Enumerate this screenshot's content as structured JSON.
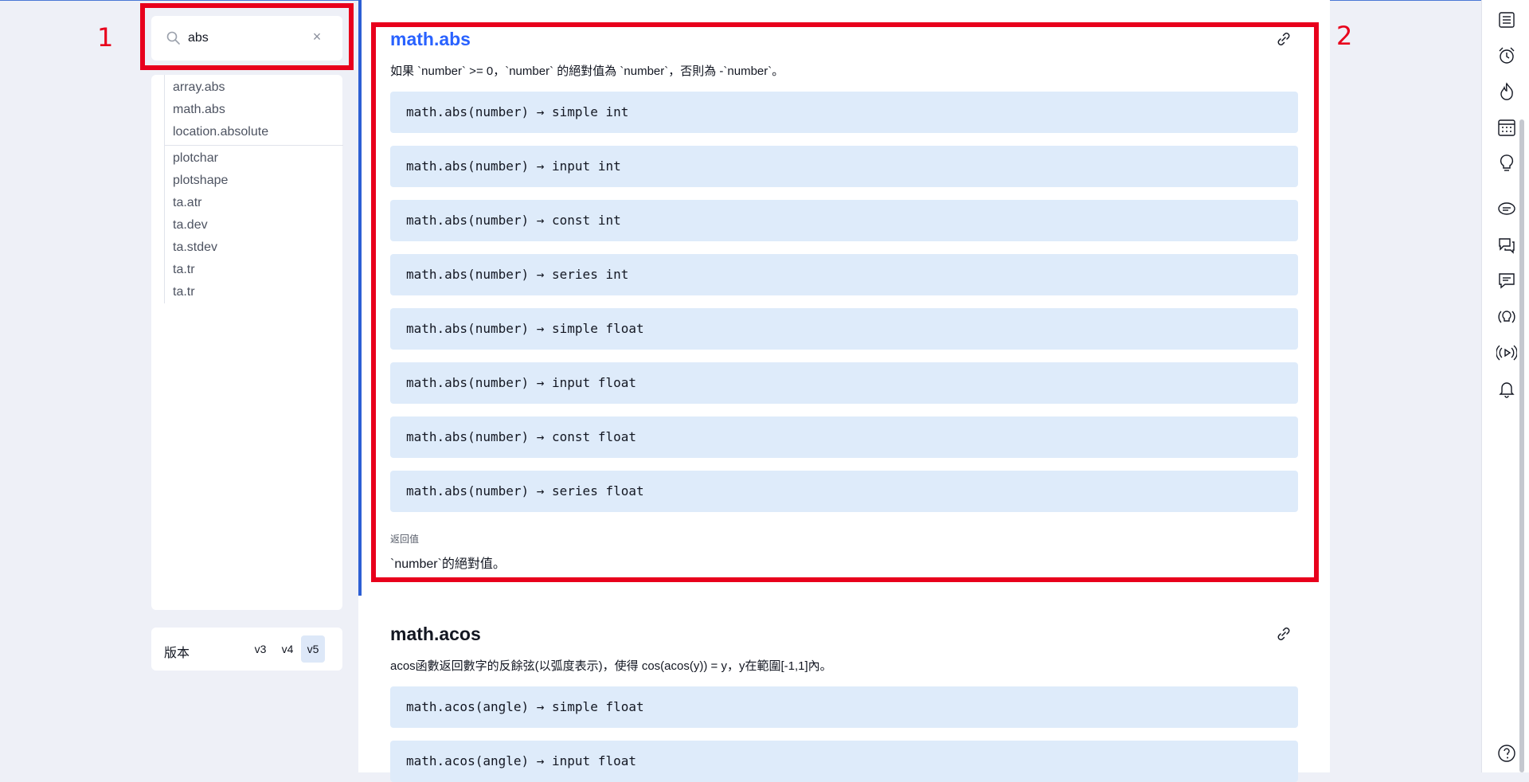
{
  "annotations": {
    "label_1": "1",
    "label_2": "2"
  },
  "search": {
    "value": "abs",
    "clear_label": "×"
  },
  "results": {
    "group_1": [
      "array.abs",
      "math.abs",
      "location.absolute"
    ],
    "group_2": [
      "plotchar",
      "plotshape",
      "ta.atr",
      "ta.dev",
      "ta.stdev",
      "ta.tr",
      "ta.tr"
    ]
  },
  "version": {
    "label": "版本",
    "options": [
      "v3",
      "v4",
      "v5"
    ],
    "selected": "v5"
  },
  "entries": [
    {
      "title": "math.abs",
      "description": "如果 `number` >= 0，`number` 的絕對值為 `number`，否則為 -`number`。",
      "signatures": [
        "math.abs(number) → simple int",
        "math.abs(number) → input int",
        "math.abs(number) → const int",
        "math.abs(number) → series int",
        "math.abs(number) → simple float",
        "math.abs(number) → input float",
        "math.abs(number) → const float",
        "math.abs(number) → series float"
      ],
      "returns_label": "返回值",
      "returns_text": "`number`的絕對值。"
    },
    {
      "title": "math.acos",
      "description": "acos函數返回數字的反餘弦(以弧度表示)，使得 cos(acos(y)) = y，y在範圍[-1,1]內。",
      "signatures": [
        "math.acos(angle) → simple float",
        "math.acos(angle) → input float"
      ]
    }
  ],
  "colors": {
    "accent": "#2962ff",
    "annotation": "#e8001c",
    "code_bg": "#deebfa"
  },
  "right_toolbar": [
    "watchlist-icon",
    "alarm-icon",
    "hotlist-icon",
    "calendar-icon",
    "ideas-icon",
    "chat-icon",
    "public-chats-icon",
    "private-chats-icon",
    "ideas-stream-icon",
    "streams-icon",
    "notifications-icon",
    "help-icon"
  ]
}
